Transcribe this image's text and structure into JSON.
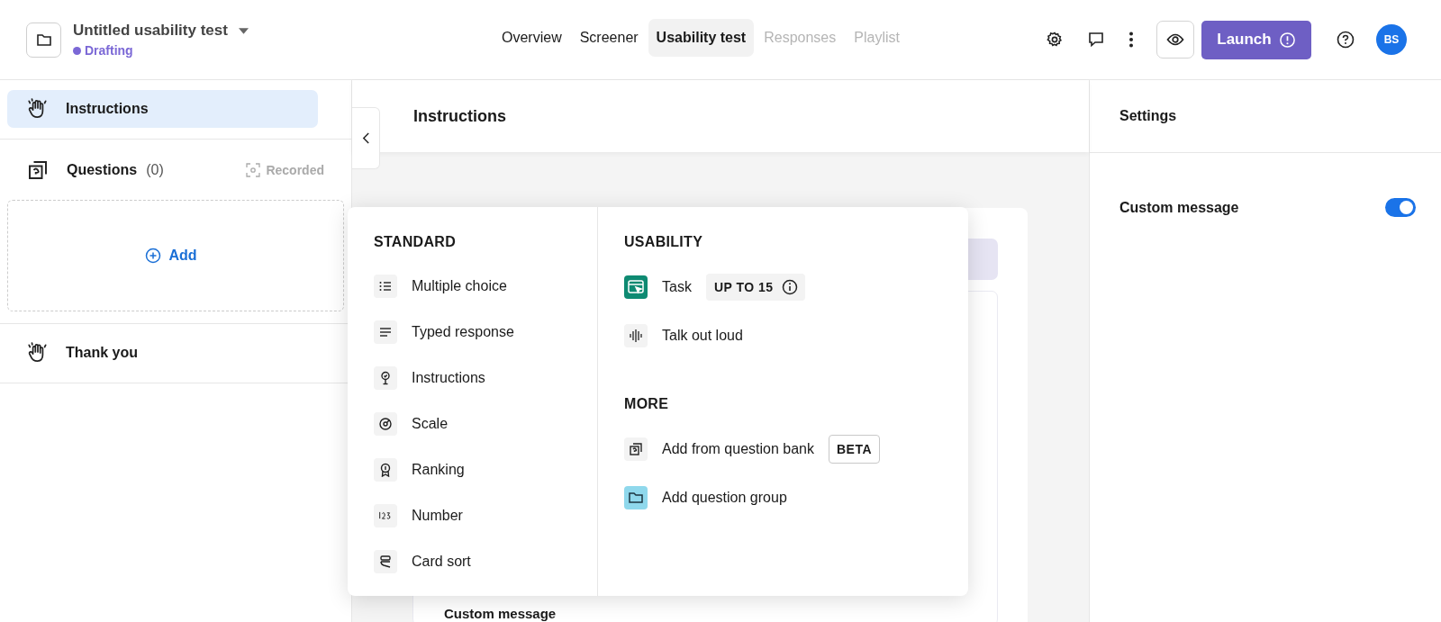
{
  "project": {
    "title": "Untitled usability test",
    "status": "Drafting"
  },
  "nav_tabs": [
    {
      "label": "Overview",
      "selected": false,
      "disabled": false
    },
    {
      "label": "Screener",
      "selected": false,
      "disabled": false
    },
    {
      "label": "Usability test",
      "selected": true,
      "disabled": false
    },
    {
      "label": "Responses",
      "selected": false,
      "disabled": true
    },
    {
      "label": "Playlist",
      "selected": false,
      "disabled": true
    }
  ],
  "launch_button": {
    "label": "Launch"
  },
  "avatar": {
    "initials": "BS"
  },
  "sidebar": {
    "instructions": {
      "label": "Instructions",
      "selected": true
    },
    "questions": {
      "label": "Questions",
      "count": "(0)",
      "recorded": "Recorded"
    },
    "add": {
      "label": "Add"
    },
    "thank_you": {
      "label": "Thank you",
      "selected": false
    }
  },
  "editor": {
    "title": "Instructions",
    "card_field": "Custom message"
  },
  "settings": {
    "title": "Settings",
    "options": [
      {
        "label": "Custom message",
        "on": true
      }
    ]
  },
  "add_menu": {
    "sections": [
      {
        "heading": "STANDARD",
        "items": [
          {
            "label": "Multiple choice"
          },
          {
            "label": "Typed response"
          },
          {
            "label": "Instructions"
          },
          {
            "label": "Scale"
          },
          {
            "label": "Ranking"
          },
          {
            "label": "Number"
          },
          {
            "label": "Card sort"
          }
        ]
      },
      {
        "heading": "USABILITY",
        "items": [
          {
            "label": "Task",
            "badge": {
              "text": "UP TO 15",
              "kind": "info"
            }
          },
          {
            "label": "Talk out loud"
          }
        ]
      },
      {
        "heading": "MORE",
        "items": [
          {
            "label": "Add from question bank",
            "badge": {
              "text": "BETA",
              "kind": "outlined"
            }
          },
          {
            "label": "Add question group"
          }
        ]
      }
    ]
  }
}
